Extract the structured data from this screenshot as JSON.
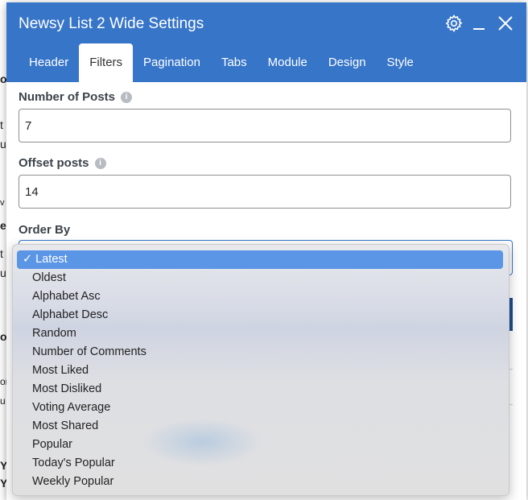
{
  "window": {
    "title": "Newsy List 2 Wide Settings",
    "icons": [
      "gear-icon",
      "minimize-icon",
      "close-icon"
    ]
  },
  "tabs": [
    {
      "label": "Header",
      "active": false
    },
    {
      "label": "Filters",
      "active": true
    },
    {
      "label": "Pagination",
      "active": false
    },
    {
      "label": "Tabs",
      "active": false
    },
    {
      "label": "Module",
      "active": false
    },
    {
      "label": "Design",
      "active": false
    },
    {
      "label": "Style",
      "active": false
    }
  ],
  "fields": {
    "number_of_posts": {
      "label": "Number of Posts",
      "value": "7"
    },
    "offset_posts": {
      "label": "Offset posts",
      "value": "14"
    },
    "order_by": {
      "label": "Order By"
    }
  },
  "dropdown": {
    "selected": "Latest",
    "check": "✓",
    "options": [
      "Latest",
      "Oldest",
      "Alphabet Asc",
      "Alphabet Desc",
      "Random",
      "Number of Comments",
      "Most Liked",
      "Most Disliked",
      "Voting Average",
      "Most Shared",
      "Popular",
      "Today's Popular",
      "Weekly Popular"
    ]
  },
  "background_fragments": [
    "o",
    "t",
    "u",
    "v",
    "e",
    "t",
    "u",
    "o",
    "or",
    "u",
    "Y",
    "Yo"
  ],
  "colors": {
    "accent": "#3775c9",
    "selected": "#5a95e6"
  }
}
